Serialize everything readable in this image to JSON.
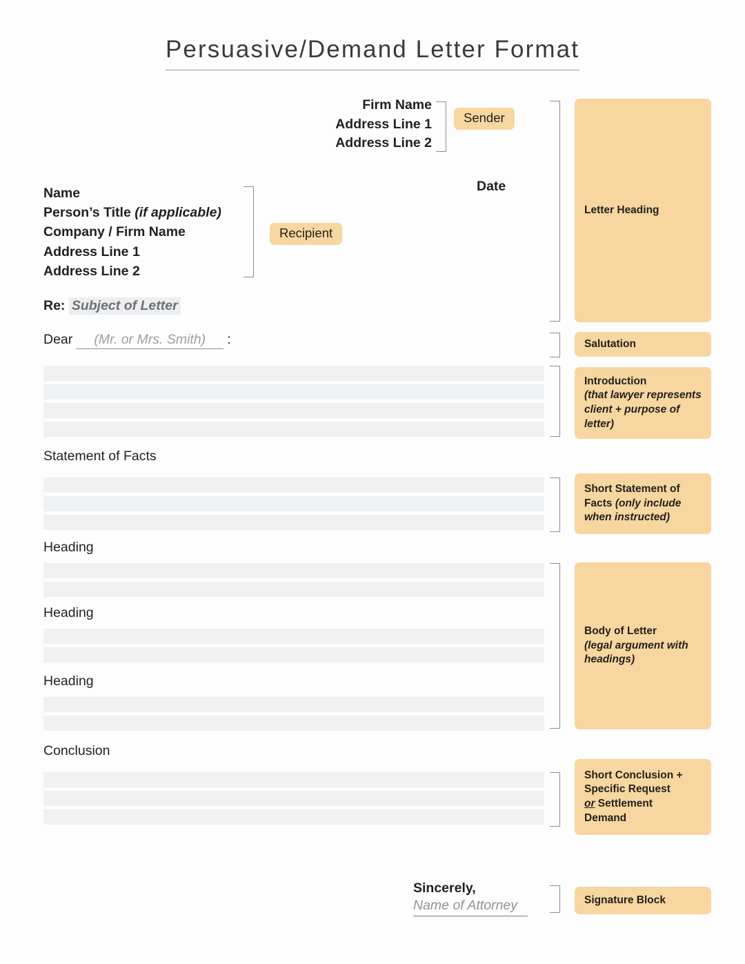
{
  "page": {
    "title": "Persuasive/Demand Letter Format",
    "accent_color": "#f7d6a0",
    "placeholder_line_color": "#f0f1f3",
    "bracket_color": "#8d8d8d",
    "background": "#fdfdfd"
  },
  "sender": {
    "lines": [
      "Firm Name",
      "Address Line 1",
      "Address Line 2"
    ],
    "badge": "Sender"
  },
  "date": {
    "label": "Date"
  },
  "recipient": {
    "name": "Name",
    "title_label": "Person’s Title ",
    "title_note": "(if applicable)",
    "company": "Company / Firm Name",
    "address1": "Address Line 1",
    "address2": "Address Line 2",
    "badge": "Recipient"
  },
  "subject": {
    "label": "Re:",
    "value": "Subject of Letter"
  },
  "salutation": {
    "greeting": "Dear",
    "placeholder": "(Mr. or Mrs. Smith)",
    "colon": ":"
  },
  "sections": {
    "statement_of_facts": "Statement of Facts",
    "heading_1": "Heading",
    "heading_2": "Heading",
    "heading_3": "Heading",
    "conclusion": "Conclusion"
  },
  "signature": {
    "closing": "Sincerely,",
    "name_placeholder": "Name of Attorney"
  },
  "annotations": {
    "letter_heading": "Letter Heading",
    "salutation": "Salutation",
    "introduction_title": "Introduction",
    "introduction_note": "(that lawyer represents client + purpose of letter)",
    "facts_title": "Short Statement of Facts ",
    "facts_note": "(only include when instructed)",
    "body_title": "Body of Letter",
    "body_note": "(legal argument with headings)",
    "conclusion_line1": "Short Conclusion +",
    "conclusion_line2": "Specific Request",
    "conclusion_or": "or",
    "conclusion_line3": " Settlement",
    "conclusion_line4": "Demand",
    "signature_block": "Signature Block"
  }
}
